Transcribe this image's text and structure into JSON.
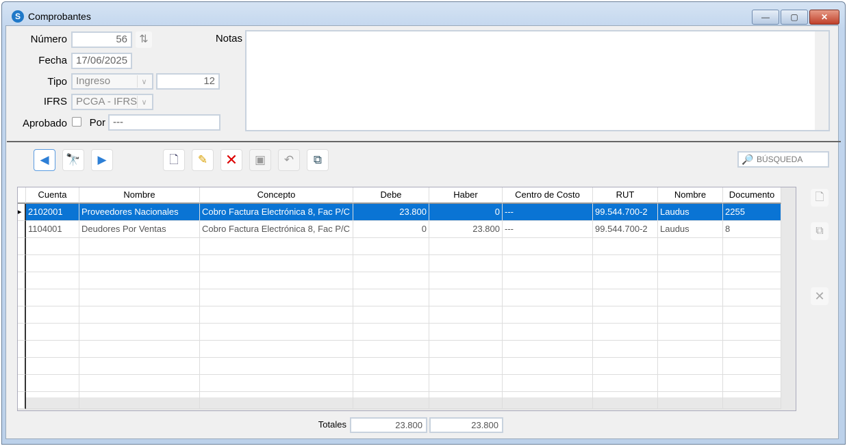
{
  "window": {
    "title": "Comprobantes",
    "min": "—",
    "max": "▢",
    "close": "✕"
  },
  "form": {
    "numero_label": "Número",
    "numero": "56",
    "fecha_label": "Fecha",
    "fecha": "17/06/2025",
    "tipo_label": "Tipo",
    "tipo": "Ingreso",
    "tipo_num": "12",
    "ifrs_label": "IFRS",
    "ifrs": "PCGA - IFRS",
    "aprobado_label": "Aprobado",
    "por_label": "Por",
    "por": "---",
    "notas_label": "Notas",
    "notas": ""
  },
  "search": {
    "placeholder": "BÚSQUEDA"
  },
  "table": {
    "columns": [
      "Cuenta",
      "Nombre",
      "Concepto",
      "Debe",
      "Haber",
      "Centro de Costo",
      "RUT",
      "Nombre",
      "Documento"
    ],
    "rows": [
      [
        "2102001",
        "Proveedores Nacionales",
        "Cobro Factura Electrónica 8, Fac P/C",
        "23.800",
        "0",
        "---",
        "99.544.700-2",
        "Laudus",
        "2255"
      ],
      [
        "1104001",
        "Deudores Por Ventas",
        "Cobro Factura Electrónica 8, Fac P/C",
        "0",
        "23.800",
        "---",
        "99.544.700-2",
        "Laudus",
        "8"
      ]
    ]
  },
  "totals": {
    "label": "Totales",
    "debe": "23.800",
    "haber": "23.800"
  }
}
